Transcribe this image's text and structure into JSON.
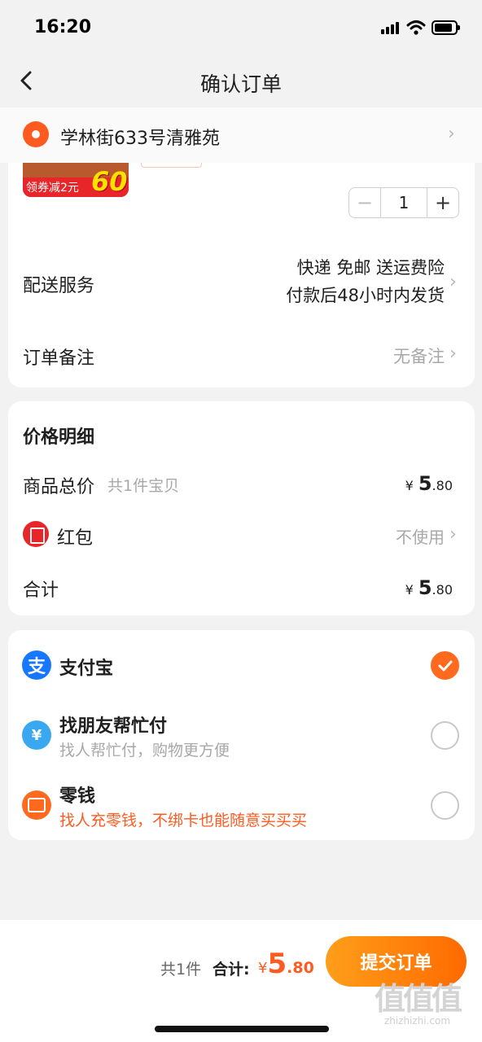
{
  "status": {
    "time": "16:20"
  },
  "nav": {
    "title": "确认订单"
  },
  "address": {
    "text": "学林街633号清雅苑"
  },
  "product": {
    "promo_text": "领券减2元",
    "promo_number": "60",
    "quantity": "1",
    "minus": "−",
    "plus": "+"
  },
  "delivery": {
    "label": "配送服务",
    "line1": "快递 免邮 送运费险",
    "line2": "付款后48小时内发货"
  },
  "remark": {
    "label": "订单备注",
    "value": "无备注"
  },
  "price_detail": {
    "title": "价格明细",
    "goods_label": "商品总价",
    "goods_sub": "共1件宝贝",
    "goods_currency": "¥",
    "goods_int": "5",
    "goods_dec": ".80",
    "hongbao_label": "红包",
    "hongbao_value": "不使用",
    "total_label": "合计",
    "total_currency": "¥",
    "total_int": "5",
    "total_dec": ".80"
  },
  "payment": {
    "alipay": {
      "title": "支付宝",
      "icon_glyph": "支",
      "selected": true
    },
    "friend": {
      "title": "找朋友帮忙付",
      "sub": "找人帮忙付，购物更方便",
      "icon_glyph": "¥"
    },
    "change": {
      "title": "零钱",
      "sub": "找人充零钱，不绑卡也能随意买买买"
    }
  },
  "bottom": {
    "count": "共1件",
    "sum_label": "合计:",
    "currency": "¥",
    "int": "5",
    "dec": ".80",
    "submit": "提交订单"
  },
  "watermark": {
    "glyph": "值值值",
    "url": "zhizhizhi.com"
  },
  "colors": {
    "accent": "#ff6a1f",
    "alipay": "#1677ff",
    "hongbao": "#e8262a"
  },
  "icons": [
    "back-arrow-icon",
    "location-pin-icon",
    "chevron-right-icon",
    "hongbao-icon",
    "alipay-icon",
    "friend-pay-icon",
    "wallet-icon",
    "check-icon"
  ]
}
